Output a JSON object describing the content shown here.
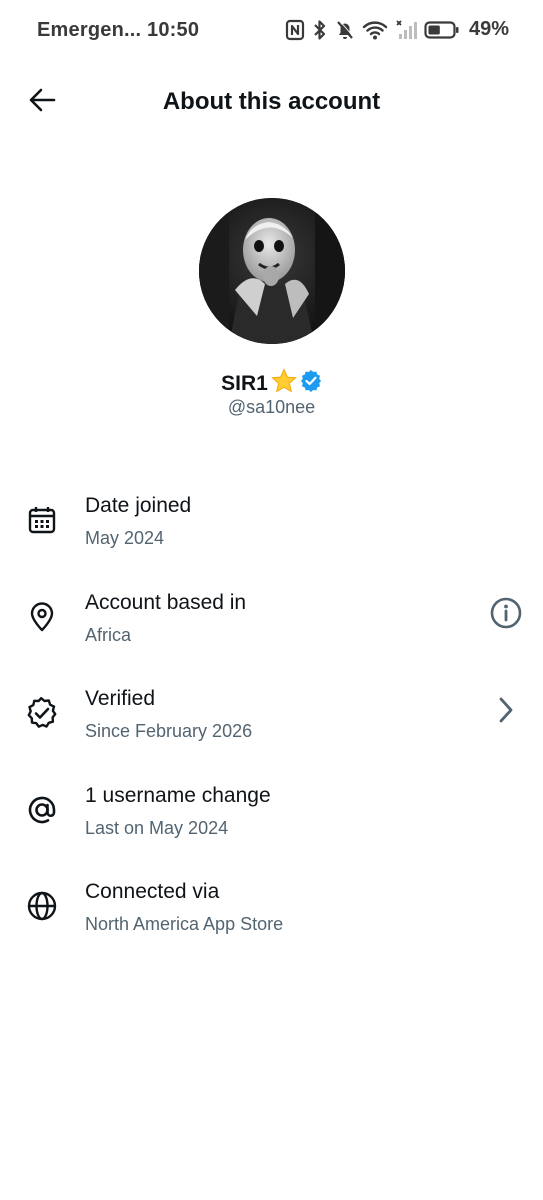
{
  "status_bar": {
    "carrier": "Emergen...",
    "time": "10:50",
    "battery_percent": "49%",
    "icons": [
      "nfc-icon",
      "bluetooth-icon",
      "mute-icon",
      "wifi-icon",
      "signal-icon",
      "battery-icon"
    ],
    "battery_level": 0.49
  },
  "header": {
    "back_icon": "arrow-left-icon",
    "title": "About this account"
  },
  "profile": {
    "display_name": "SIR1",
    "name_emoji": "star",
    "verified_badge": "verified-badge-icon",
    "handle": "@sa10nee"
  },
  "rows": [
    {
      "icon": "calendar-icon",
      "title": "Date joined",
      "subtitle": "May 2024",
      "action": ""
    },
    {
      "icon": "location-pin-icon",
      "title": "Account based in",
      "subtitle": "Africa",
      "action": "info-icon"
    },
    {
      "icon": "verified-outline-icon",
      "title": "Verified",
      "subtitle": "Since February 2026",
      "action": "chevron-right-icon"
    },
    {
      "icon": "at-sign-icon",
      "title": "1 username change",
      "subtitle": "Last on May 2024",
      "action": ""
    },
    {
      "icon": "globe-icon",
      "title": "Connected via",
      "subtitle": "North America App Store",
      "action": ""
    }
  ],
  "colors": {
    "text_primary": "#0f1419",
    "text_secondary": "#536471",
    "verified_blue": "#1d9bf0",
    "star_yellow": "#ffcc33",
    "background": "#ffffff"
  }
}
